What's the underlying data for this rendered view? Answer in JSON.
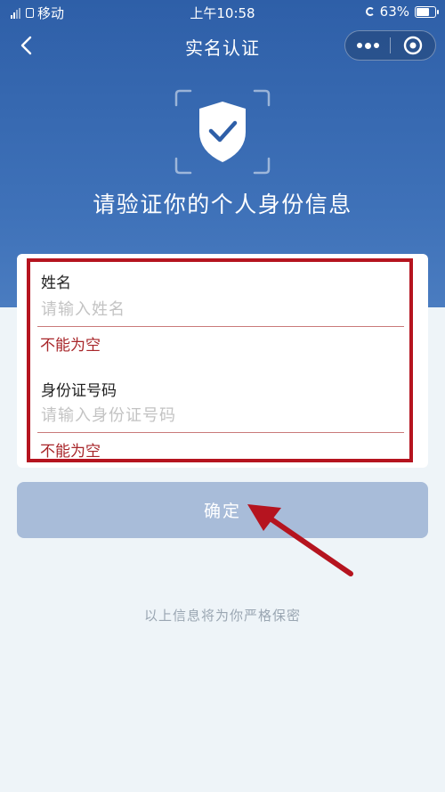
{
  "status_bar": {
    "carrier": "移动",
    "time": "上午10:58",
    "battery": "63%",
    "battery_level": 0.63
  },
  "nav": {
    "title": "实名认证",
    "back_icon": "chevron-left-icon",
    "more_icon": "more-dots-icon",
    "close_icon": "target-circle-icon"
  },
  "hero": {
    "icon": "shield-check-icon",
    "headline": "请验证你的个人身份信息"
  },
  "form": {
    "fields": [
      {
        "label": "姓名",
        "placeholder": "请输入姓名",
        "value": "",
        "error": "不能为空"
      },
      {
        "label": "身份证号码",
        "placeholder": "请输入身份证号码",
        "value": "",
        "error": "不能为空"
      }
    ]
  },
  "confirm_button": {
    "label": "确定"
  },
  "footer": {
    "note": "以上信息将为你严格保密"
  },
  "colors": {
    "header_blue": "#2e5fa8",
    "button_disabled": "#a8bcd9",
    "error_red": "#a8262a",
    "annotation_red": "#b5141f",
    "page_bg": "#eef4f8"
  }
}
